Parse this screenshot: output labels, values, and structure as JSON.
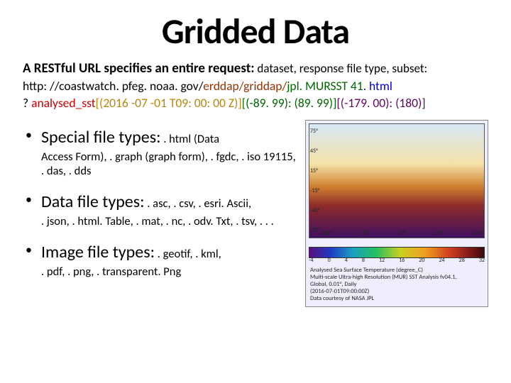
{
  "title": "Gridded Data",
  "request_lead_bold": "A RESTful URL specifies an entire request:",
  "request_lead_rest": " dataset, response file type, subset:",
  "url": {
    "p1": "http: //coastwatch. pfeg. noaa. gov/",
    "p2": "erddap/griddap/",
    "p3": "jpl. MURSST 41",
    "p4": ". html",
    "p5": "? ",
    "p6": "analysed_sst",
    "p7": "[(2016 -07 -01 T09: 00: 00 Z)]",
    "p8": "[(-89. 99): (89. 99)]",
    "p9": "[(-179. 00): (180)]"
  },
  "bullets": [
    {
      "head": "Special file types:",
      "tail": " . html (Data",
      "detail": "Access Form), . graph (graph form), . fgdc, . iso 19115, . das, . dds"
    },
    {
      "head": "Data file types:",
      "tail": " . asc, . csv, . esri. Ascii,",
      "detail": ". json, . html. Table, . mat, . nc, . odv. Txt, . tsv, . . ."
    },
    {
      "head": "Image file types:",
      "tail": " . geotif, . kml,",
      "detail": ". pdf, . png, . transparent. Png"
    }
  ],
  "figure": {
    "lat_ticks": [
      "75°",
      "45°",
      "15°",
      "-15°",
      "-45°",
      "-75°"
    ],
    "lon_ticks": [
      "-180°",
      "-135°",
      "-90°",
      "-45°",
      "0°",
      "45°",
      "90°",
      "135°",
      "180°"
    ],
    "cb_ticks": [
      "-4",
      "0",
      "4",
      "8",
      "12",
      "16",
      "20",
      "24",
      "28",
      "32"
    ],
    "caption_l1": "Analysed Sea Surface Temperature (degree_C)",
    "caption_l2": "Multi-scale Ultra-high Resolution (MUR) SST Analysis fv04.1,",
    "caption_l3": "Global, 0.01°, Daily",
    "caption_l4": "(2016-07-01T09:00:00Z)",
    "caption_l5": "Data courtesy of NASA JPL"
  }
}
